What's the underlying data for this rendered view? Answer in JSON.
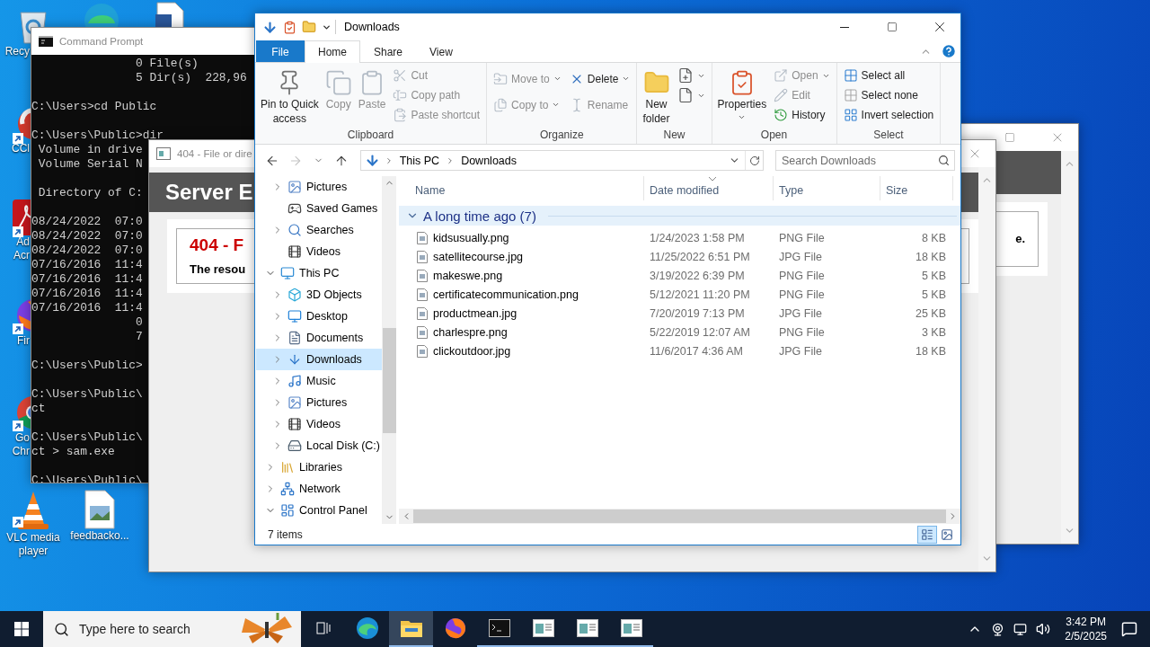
{
  "desktop": {
    "icons": [
      {
        "kind": "recycle_bin",
        "label": [
          "Recy"
        ],
        "shortcut": false
      },
      {
        "kind": "edge",
        "shortcut": false
      },
      {
        "kind": "document",
        "shortcut": false
      },
      {
        "kind": "ccleaner",
        "label": [
          "CCl"
        ],
        "shortcut": true
      },
      {
        "kind": "acrobat",
        "label": [
          "Ad",
          "Acr"
        ],
        "shortcut": true
      },
      {
        "kind": "firefox",
        "label": [
          "Fir"
        ],
        "shortcut": true
      },
      {
        "kind": "chrome",
        "label": [
          "Go",
          "Chr"
        ],
        "shortcut": true
      },
      {
        "kind": "vlc",
        "label": [
          "VLC media",
          "player"
        ],
        "shortcut": true
      },
      {
        "kind": "image_file",
        "label": [
          "feedbacko..."
        ],
        "shortcut": false
      }
    ]
  },
  "command_prompt": {
    "title": "Command Prompt",
    "blocks": [
      [
        "               0 File(s)",
        "               5 Dir(s)  228,96"
      ],
      [
        "C:\\Users>cd Public"
      ],
      [
        "C:\\Users\\Public>dir",
        " Volume in drive",
        " Volume Serial N"
      ],
      [
        " Directory of C:"
      ],
      [
        "08/24/2022  07:0",
        "08/24/2022  07:0",
        "08/24/2022  07:0",
        "07/16/2016  11:4",
        "07/16/2016  11:4",
        "07/16/2016  11:4",
        "07/16/2016  11:4",
        "               0",
        "               7"
      ],
      [
        "C:\\Users\\Public>"
      ],
      [
        "C:\\Users\\Public\\",
        "ct"
      ],
      [
        "C:\\Users\\Public\\",
        "ct > sam.exe"
      ],
      [
        "C:\\Users\\Public\\"
      ]
    ]
  },
  "back_window": {
    "text": "e."
  },
  "error_window": {
    "title": "404 - File or dire",
    "banner": "Server E",
    "error_heading": "404 - F",
    "error_message": "The resou"
  },
  "explorer": {
    "title": "Downloads",
    "ribbon_tabs": [
      {
        "label": "File",
        "kind": "file",
        "selected": false
      },
      {
        "label": "Home",
        "kind": "tab",
        "selected": true
      },
      {
        "label": "Share",
        "kind": "tab",
        "selected": false
      },
      {
        "label": "View",
        "kind": "tab",
        "selected": false
      }
    ],
    "ribbon_groups": [
      {
        "label": "Clipboard",
        "columns": [
          [
            {
              "kind": "pin",
              "label": [
                "Pin to Quick",
                "access"
              ],
              "disabled": false,
              "dropdown": false
            }
          ],
          [
            {
              "kind": "copy",
              "label": [
                "Copy"
              ],
              "disabled": true,
              "dropdown": false
            }
          ],
          [
            {
              "kind": "paste",
              "label": [
                "Paste"
              ],
              "disabled": true,
              "dropdown": false
            }
          ],
          [
            {
              "kind": "cut",
              "label": "Cut",
              "disabled": true,
              "dropdown": false
            },
            {
              "kind": "copy_path",
              "label": "Copy path",
              "disabled": true,
              "dropdown": false
            },
            {
              "kind": "paste_shortcut",
              "label": "Paste shortcut",
              "disabled": true,
              "dropdown": false
            }
          ]
        ]
      },
      {
        "label": "Organize",
        "columns": [
          [
            {
              "kind": "move_to",
              "label": "Move to",
              "disabled": true,
              "dropdown": true
            },
            {
              "kind": "copy_to",
              "label": "Copy to",
              "disabled": true,
              "dropdown": true
            }
          ],
          [
            {
              "kind": "delete",
              "label": "Delete",
              "disabled": false,
              "dropdown": true
            },
            {
              "kind": "rename",
              "label": "Rename",
              "disabled": true,
              "dropdown": false
            }
          ]
        ]
      },
      {
        "label": "New",
        "columns": [
          [
            {
              "kind": "new_folder",
              "label": [
                "New",
                "folder"
              ],
              "disabled": false,
              "dropdown": false
            }
          ],
          [
            {
              "kind": "new_item",
              "disabled": false,
              "dropdown": true
            },
            {
              "kind": "easy_access",
              "disabled": false,
              "dropdown": true
            }
          ]
        ]
      },
      {
        "label": "Open",
        "columns": [
          [
            {
              "kind": "properties",
              "label": [
                "Properties"
              ],
              "disabled": false,
              "dropdown": true
            }
          ],
          [
            {
              "kind": "open",
              "label": "Open",
              "disabled": true,
              "dropdown": true
            },
            {
              "kind": "edit",
              "label": "Edit",
              "disabled": true,
              "dropdown": false
            },
            {
              "kind": "history",
              "label": "History",
              "disabled": false,
              "dropdown": false
            }
          ]
        ]
      },
      {
        "label": "Select",
        "columns": [
          [
            {
              "kind": "select_all",
              "label": "Select all",
              "disabled": false,
              "dropdown": false
            },
            {
              "kind": "select_none",
              "label": "Select none",
              "disabled": false,
              "dropdown": false
            },
            {
              "kind": "invert",
              "label": "Invert selection",
              "disabled": false,
              "dropdown": false
            }
          ]
        ]
      }
    ],
    "nav_buttons": [
      {
        "kind": "back",
        "disabled": false
      },
      {
        "kind": "forward",
        "disabled": true
      },
      {
        "kind": "recent",
        "disabled": false
      },
      {
        "kind": "up",
        "disabled": false
      }
    ],
    "address": [
      "This PC",
      "Downloads"
    ],
    "search": {
      "placeholder": "Search Downloads"
    },
    "nav_tree": [
      {
        "children": [
          {
            "label": "Pictures",
            "kind": "pictures",
            "expandable": true,
            "expanded": false,
            "selected": false
          },
          {
            "label": "Saved Games",
            "kind": "games",
            "expandable": false,
            "selected": false
          },
          {
            "label": "Searches",
            "kind": "searches",
            "expandable": true,
            "expanded": false,
            "selected": false
          },
          {
            "label": "Videos",
            "kind": "videos",
            "expandable": false,
            "selected": false
          }
        ]
      },
      {
        "label": "This PC",
        "kind": "pc",
        "expandable": true,
        "expanded": true,
        "selected": false,
        "children": [
          {
            "label": "3D Objects",
            "kind": "objects",
            "expandable": true,
            "expanded": false,
            "selected": false
          },
          {
            "label": "Desktop",
            "kind": "desktop",
            "expandable": true,
            "expanded": false,
            "selected": false
          },
          {
            "label": "Documents",
            "kind": "documents",
            "expandable": true,
            "expanded": false,
            "selected": false
          },
          {
            "label": "Downloads",
            "kind": "downloads",
            "expandable": true,
            "expanded": false,
            "selected": true
          },
          {
            "label": "Music",
            "kind": "music",
            "expandable": true,
            "expanded": false,
            "selected": false
          },
          {
            "label": "Pictures",
            "kind": "pictures",
            "expandable": true,
            "expanded": false,
            "selected": false
          },
          {
            "label": "Videos",
            "kind": "videos",
            "expandable": true,
            "expanded": false,
            "selected": false
          },
          {
            "label": "Local Disk (C:)",
            "kind": "disk",
            "expandable": true,
            "expanded": false,
            "selected": false
          }
        ]
      },
      {
        "label": "Libraries",
        "kind": "libraries",
        "expandable": true,
        "expanded": false,
        "selected": false
      },
      {
        "label": "Network",
        "kind": "network",
        "expandable": true,
        "expanded": false,
        "selected": false
      },
      {
        "label": "Control Panel",
        "kind": "control_panel",
        "expandable": true,
        "expanded": true,
        "selected": false
      }
    ],
    "columns": [
      {
        "label": "Name",
        "sorted": false
      },
      {
        "label": "Date modified",
        "sorted": true
      },
      {
        "label": "Type",
        "sorted": false
      },
      {
        "label": "Size",
        "sorted": false
      }
    ],
    "groups": [
      {
        "label": "A long time ago (7)",
        "expanded": true,
        "rows": [
          {
            "name": "kidsusually.png",
            "date": "1/24/2023 1:58 PM",
            "type": "PNG File",
            "size": "8 KB"
          },
          {
            "name": "satellitecourse.jpg",
            "date": "11/25/2022 6:51 PM",
            "type": "JPG File",
            "size": "18 KB"
          },
          {
            "name": "makeswe.png",
            "date": "3/19/2022 6:39 PM",
            "type": "PNG File",
            "size": "5 KB"
          },
          {
            "name": "certificatecommunication.png",
            "date": "5/12/2021 11:20 PM",
            "type": "PNG File",
            "size": "5 KB"
          },
          {
            "name": "productmean.jpg",
            "date": "7/20/2019 7:13 PM",
            "type": "JPG File",
            "size": "25 KB"
          },
          {
            "name": "charlespre.png",
            "date": "5/22/2019 12:07 AM",
            "type": "PNG File",
            "size": "3 KB"
          },
          {
            "name": "clickoutdoor.jpg",
            "date": "11/6/2017 4:36 AM",
            "type": "JPG File",
            "size": "18 KB"
          }
        ]
      }
    ],
    "status": "7 items",
    "views": [
      {
        "kind": "details",
        "selected": true
      },
      {
        "kind": "large_icons",
        "selected": false
      }
    ]
  },
  "taskbar": {
    "search": {
      "placeholder": "Type here to search"
    },
    "apps": [
      {
        "kind": "task_view",
        "active": false,
        "open": false
      },
      {
        "kind": "edge",
        "active": false,
        "open": false
      },
      {
        "kind": "explorer",
        "active": true,
        "open": true
      },
      {
        "kind": "firefox",
        "active": false,
        "open": false
      },
      {
        "kind": "cmd",
        "active": false,
        "open": true
      },
      {
        "kind": "app_window",
        "active": false,
        "open": true
      },
      {
        "kind": "app_window",
        "active": false,
        "open": true
      },
      {
        "kind": "app_window",
        "active": false,
        "open": true
      }
    ],
    "clock": {
      "time": "3:42 PM",
      "date": "2/5/2025"
    }
  }
}
